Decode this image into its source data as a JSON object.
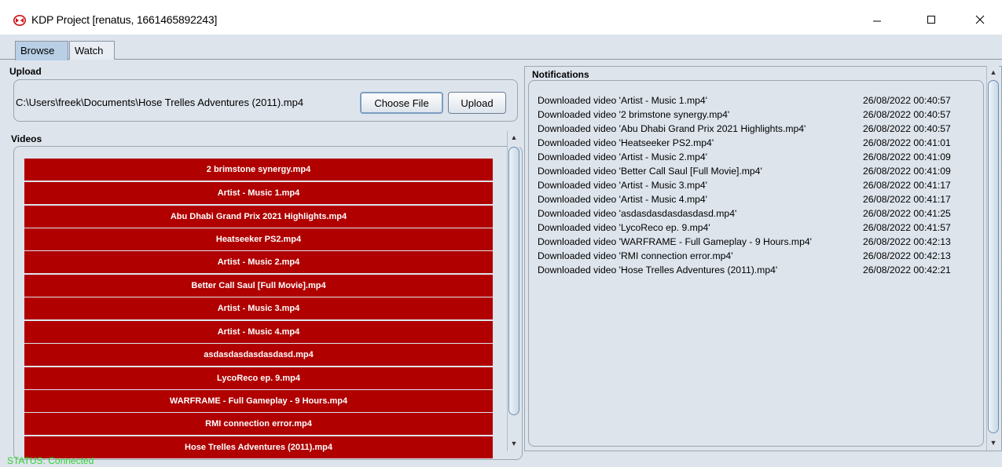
{
  "window": {
    "title": "KDP Project [renatus, 1661465892243]",
    "icon": "kdp-app-icon"
  },
  "tabs": [
    {
      "label": "Browse",
      "active": true
    },
    {
      "label": "Watch",
      "active": false
    }
  ],
  "upload": {
    "section_title": "Upload",
    "file_path": "C:\\Users\\freek\\Documents\\Hose Trelles Adventures (2011).mp4",
    "choose_label": "Choose File",
    "upload_label": "Upload"
  },
  "videos": {
    "section_title": "Videos",
    "items": [
      "2 brimstone synergy.mp4",
      "Artist - Music 1.mp4",
      "Abu Dhabi Grand Prix 2021 Highlights.mp4",
      "Heatseeker PS2.mp4",
      "Artist - Music 2.mp4",
      "Better Call Saul [Full Movie].mp4",
      "Artist - Music 3.mp4",
      "Artist - Music 4.mp4",
      "asdasdasdasdasdasd.mp4",
      "LycoReco ep. 9.mp4",
      "WARFRAME - Full Gameplay - 9 Hours.mp4",
      "RMI connection error.mp4",
      "Hose Trelles Adventures (2011).mp4"
    ],
    "item_color": "#b00000"
  },
  "notifications": {
    "section_title": "Notifications",
    "rows": [
      {
        "message": "Downloaded video 'Artist - Music 1.mp4'",
        "time": "26/08/2022 00:40:57"
      },
      {
        "message": "Downloaded video '2 brimstone synergy.mp4'",
        "time": "26/08/2022 00:40:57"
      },
      {
        "message": "Downloaded video 'Abu Dhabi Grand Prix 2021 Highlights.mp4'",
        "time": "26/08/2022 00:40:57"
      },
      {
        "message": "Downloaded video 'Heatseeker PS2.mp4'",
        "time": "26/08/2022 00:41:01"
      },
      {
        "message": "Downloaded video 'Artist - Music 2.mp4'",
        "time": "26/08/2022 00:41:09"
      },
      {
        "message": "Downloaded video 'Better Call Saul [Full Movie].mp4'",
        "time": "26/08/2022 00:41:09"
      },
      {
        "message": "Downloaded video 'Artist - Music 3.mp4'",
        "time": "26/08/2022 00:41:17"
      },
      {
        "message": "Downloaded video 'Artist - Music 4.mp4'",
        "time": "26/08/2022 00:41:17"
      },
      {
        "message": "Downloaded video 'asdasdasdasdasdasd.mp4'",
        "time": "26/08/2022 00:41:25"
      },
      {
        "message": "Downloaded video 'LycoReco ep. 9.mp4'",
        "time": "26/08/2022 00:41:57"
      },
      {
        "message": "Downloaded video 'WARFRAME - Full Gameplay - 9 Hours.mp4'",
        "time": "26/08/2022 00:42:13"
      },
      {
        "message": "Downloaded video 'RMI connection error.mp4'",
        "time": "26/08/2022 00:42:13"
      },
      {
        "message": "Downloaded video 'Hose Trelles Adventures (2011).mp4'",
        "time": "26/08/2022 00:42:21"
      }
    ]
  },
  "status": {
    "text": "STATUS: Connected",
    "color": "#2fd12f"
  }
}
